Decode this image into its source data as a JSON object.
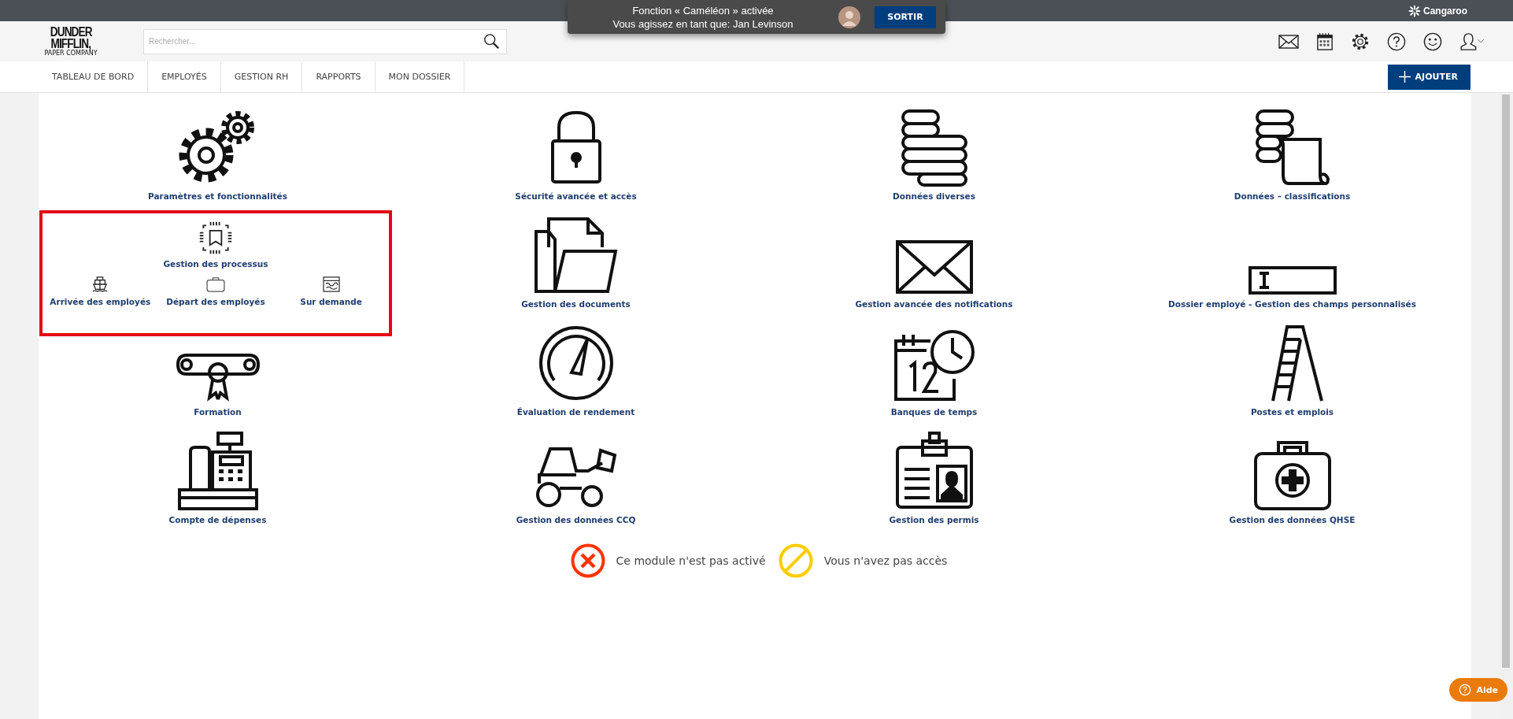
{
  "impersonation": {
    "line_1": "Fonction « Caméléon » activée",
    "line_2": "Vous agissez en tant que: Jan Levinson",
    "exit_button": "SORTIR"
  },
  "brand": "Cangaroo",
  "logo": {
    "line_1": "DUNDER",
    "line_2": "MIFFLIN,",
    "tagline": "PAPER COMPANY"
  },
  "search": {
    "placeholder": "Rechercher..."
  },
  "nav_tabs": [
    {
      "label": "TABLEAU DE BORD",
      "selected": false
    },
    {
      "label": "EMPLOYÉS",
      "selected": false
    },
    {
      "label": "GESTION RH",
      "selected": false
    },
    {
      "label": "RAPPORTS",
      "selected": false
    },
    {
      "label": "MON DOSSIER",
      "selected": false
    }
  ],
  "add_button": "AJOUTER",
  "modules": [
    {
      "kind": "gears",
      "label": "Paramètres et fonctionnalités",
      "highlighted": false
    },
    {
      "kind": "padlock",
      "label": "Sécurité avancée et accès",
      "highlighted": false
    },
    {
      "kind": "database",
      "label": "Données diverses",
      "highlighted": false
    },
    {
      "kind": "database-scroll",
      "label": "Données – classifications",
      "highlighted": false
    },
    {
      "kind": "process-group",
      "label": "Gestion des processus",
      "highlighted": true,
      "sub_items": [
        {
          "kind": "ship",
          "label": "Arrivée des employés"
        },
        {
          "kind": "suitcase",
          "label": "Départ des employés"
        },
        {
          "kind": "map",
          "label": "Sur demande"
        }
      ]
    },
    {
      "kind": "folder",
      "label": "Gestion des documents",
      "highlighted": false
    },
    {
      "kind": "envelope",
      "label": "Gestion avancée des notifications",
      "highlighted": false
    },
    {
      "kind": "text-field",
      "label": "Dossier employé - Gestion des champs personnalisés",
      "highlighted": false
    },
    {
      "kind": "diploma",
      "label": "Formation",
      "highlighted": false
    },
    {
      "kind": "gauge",
      "label": "Évaluation de rendement",
      "highlighted": false
    },
    {
      "kind": "calendar-clock",
      "label": "Banques de temps",
      "highlighted": false
    },
    {
      "kind": "ladder",
      "label": "Postes et emplois",
      "highlighted": false
    },
    {
      "kind": "cash-register",
      "label": "Compte de dépenses",
      "highlighted": false
    },
    {
      "kind": "loader",
      "label": "Gestion des données CCQ",
      "highlighted": false
    },
    {
      "kind": "id-badge",
      "label": "Gestion des permis",
      "highlighted": false
    },
    {
      "kind": "first-aid-kit",
      "label": "Gestion des données QHSE",
      "highlighted": false
    }
  ],
  "legend": [
    {
      "kind": "inactive",
      "label": "Ce module n'est pas activé",
      "color": "#ff3300"
    },
    {
      "kind": "no-access",
      "label": "Vous n'avez pas accès",
      "color": "#ffcc00"
    }
  ],
  "help_button": "Aide"
}
